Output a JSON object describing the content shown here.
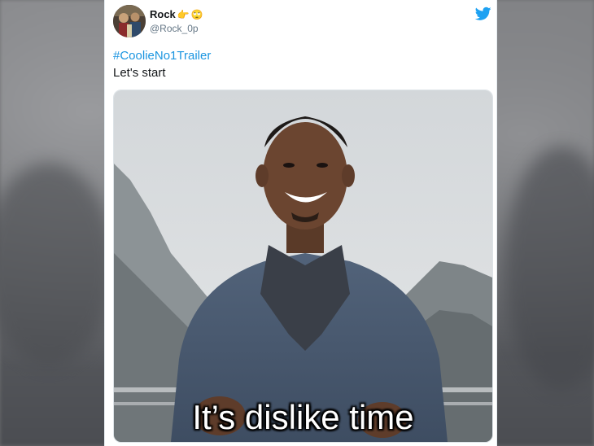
{
  "tweet": {
    "display_name": "Rock",
    "name_emojis": [
      "👉",
      "🙄"
    ],
    "handle": "@Rock_0p",
    "hashtag": "#CoolieNo1Trailer",
    "text": "Let's start"
  },
  "media": {
    "caption": "It’s dislike time"
  },
  "icons": {
    "brand": "twitter-bird-icon"
  },
  "colors": {
    "brand": "#1da1f2",
    "hashtag": "#1b95e0",
    "name": "#14171a",
    "handle": "#657786"
  }
}
